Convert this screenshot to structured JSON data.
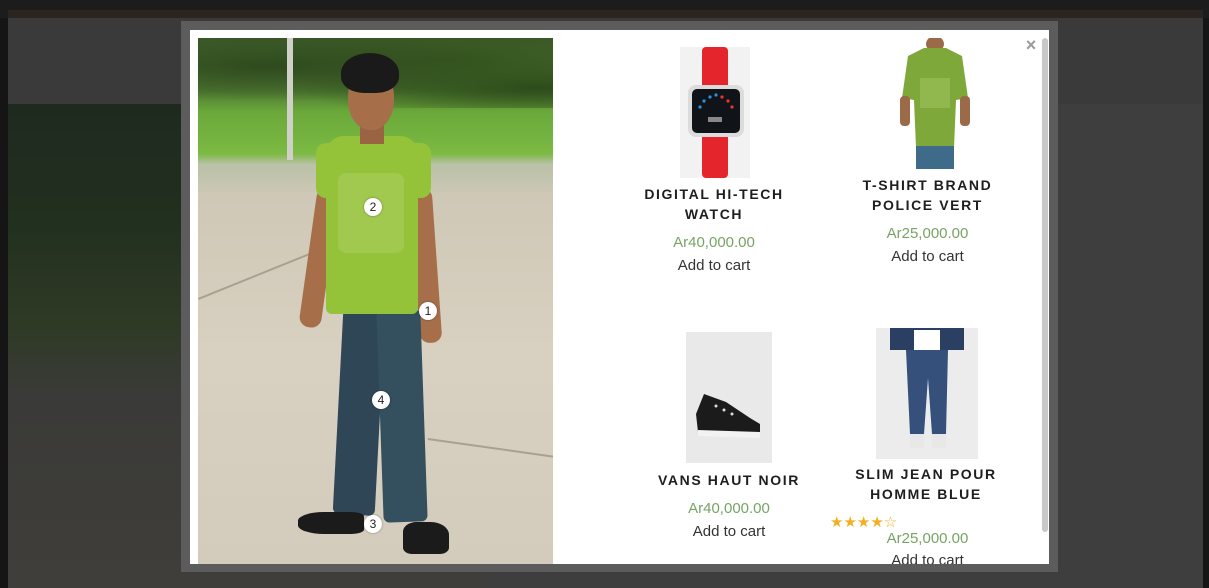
{
  "modal": {
    "close_label": "×",
    "hotspots": [
      "1",
      "2",
      "3",
      "4"
    ]
  },
  "products": [
    {
      "name": "DIGITAL HI-TECH WATCH",
      "price": "Ar40,000.00",
      "cart_label": "Add to cart",
      "image": "red digital watch"
    },
    {
      "name": "T-SHIRT BRAND POLICE VERT",
      "price": "Ar25,000.00",
      "cart_label": "Add to cart",
      "image": "green t-shirt"
    },
    {
      "name": "VANS HAUT NOIR",
      "price": "Ar40,000.00",
      "cart_label": "Add to cart",
      "image": "black sneaker"
    },
    {
      "name": "SLIM JEAN POUR HOMME BLUE",
      "price": "Ar25,000.00",
      "cart_label": "Add to cart",
      "image": "blue slim jeans",
      "rating_stars": "★★★★☆",
      "rating": 4
    }
  ],
  "colors": {
    "price": "#77a464",
    "star": "#f2b01e",
    "overlay": "#3b3b3b"
  }
}
